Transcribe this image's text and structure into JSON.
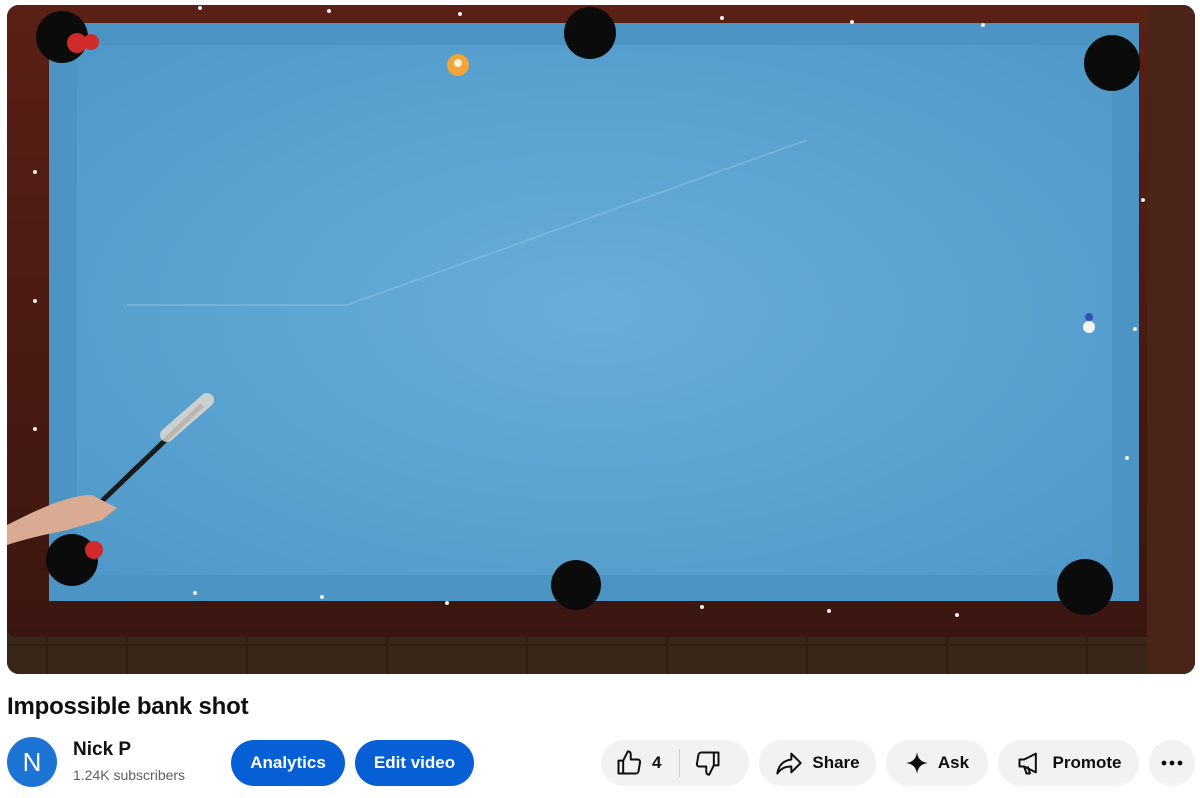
{
  "video": {
    "title": "Impossible bank shot"
  },
  "channel": {
    "avatar_letter": "N",
    "name": "Nick P",
    "subscribers": "1.24K subscribers"
  },
  "actions": {
    "analytics_label": "Analytics",
    "edit_label": "Edit video",
    "like_count": "4",
    "share_label": "Share",
    "ask_label": "Ask",
    "promote_label": "Promote"
  },
  "icons": {
    "like": "thumbs-up-icon",
    "dislike": "thumbs-down-icon",
    "share": "share-arrow-icon",
    "ask": "sparkle-icon",
    "promote": "megaphone-icon",
    "more": "more-horizontal-icon"
  },
  "colors": {
    "primary_button": "#065fd4",
    "secondary_button": "#f2f2f2",
    "avatar": "#1c74d4",
    "cloth": "#5fa6d3",
    "rail_wood": "#5a1f16"
  }
}
